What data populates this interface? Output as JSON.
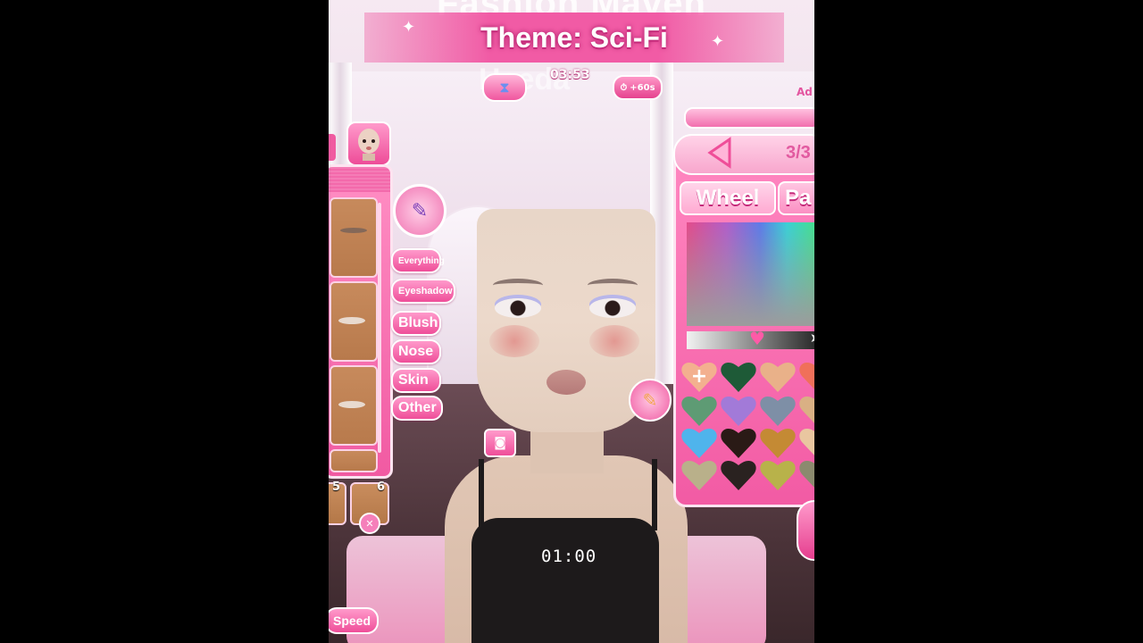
{
  "banner": {
    "ghost_title": "Fashion Maven",
    "theme_label": "Theme: Sci-Fi",
    "ghost_name": "Haeda"
  },
  "hud": {
    "timer": "03:53",
    "bonus_time": "+60s",
    "ad_label": "Ad"
  },
  "left_panel": {
    "categories": [
      "Everything",
      "Eyeshadow",
      "Blush",
      "Nose",
      "Skin",
      "Other"
    ],
    "page_numbers": [
      "5",
      "6"
    ],
    "speed_label": "Speed"
  },
  "right_panel": {
    "page": "3/3",
    "tabs": [
      "Wheel",
      "Pa"
    ],
    "swatches": [
      "#f3b08f",
      "#1e5a37",
      "#e9b189",
      "#f0705a",
      "#5e9b74",
      "#a27ad8",
      "#7e8fa6",
      "#d9b084",
      "#4fb4ec",
      "#2a1a16",
      "#c48a34",
      "#e9c6a0",
      "#b9b08a",
      "#2a2220",
      "#b8b24a",
      "#8b8a6e"
    ]
  },
  "video": {
    "timestamp": "01:00"
  }
}
